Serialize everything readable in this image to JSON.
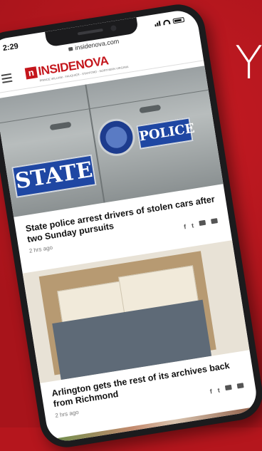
{
  "status": {
    "time": "2:29"
  },
  "browser": {
    "url": "insidenova.com"
  },
  "site": {
    "logo_mark": "n",
    "logo_inside": "INSIDE",
    "logo_nova": "NOVA",
    "tagline": "PRINCE WILLIAM - FAUQUIER - STAFFORD - NORTHERN VIRGINIA"
  },
  "background": {
    "text": "Y"
  },
  "articles": [
    {
      "image_text_1": "STATE",
      "image_text_2": "POLICE",
      "headline": "State police arrest drivers of stolen cars after two Sunday pursuits",
      "time": "2 hrs ago"
    },
    {
      "headline": "Arlington gets the rest of its archives back from Richmond",
      "time": "2 hrs ago"
    }
  ],
  "share_icons": [
    "f",
    "t",
    "comment",
    "email"
  ],
  "colors": {
    "accent": "#c4161c",
    "background": "#b5161d"
  }
}
